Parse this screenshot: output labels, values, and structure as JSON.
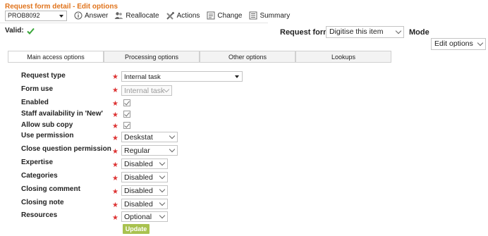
{
  "header": {
    "title": "Request form detail - Edit options",
    "record_id": "PROB8092",
    "actions": [
      {
        "label": "Answer",
        "icon": "info-icon"
      },
      {
        "label": "Reallocate",
        "icon": "users-icon"
      },
      {
        "label": "Actions",
        "icon": "tools-icon"
      },
      {
        "label": "Change",
        "icon": "edit-icon"
      },
      {
        "label": "Summary",
        "icon": "list-icon"
      }
    ],
    "valid_label": "Valid:",
    "request_form_label": "Request form",
    "request_form_value": "Digitise this item",
    "mode_label": "Mode",
    "mode_value": "Edit options"
  },
  "tabs": [
    {
      "label": "Main access options",
      "active": true
    },
    {
      "label": "Processing options",
      "active": false
    },
    {
      "label": "Other options",
      "active": false
    },
    {
      "label": "Lookups",
      "active": false
    }
  ],
  "form": {
    "required_marker": "★",
    "fields": {
      "request_type": {
        "label": "Request type",
        "value": "Internal task"
      },
      "form_use": {
        "label": "Form use",
        "value": "Internal task"
      },
      "enabled": {
        "label": "Enabled",
        "checked": true
      },
      "staff_availability": {
        "label": "Staff availability in 'New'",
        "checked": true
      },
      "allow_sub_copy": {
        "label": "Allow sub copy",
        "checked": true
      },
      "use_permission": {
        "label": "Use permission",
        "value": "Deskstat"
      },
      "close_question_permission": {
        "label": "Close question permission",
        "value": "Regular"
      },
      "expertise": {
        "label": "Expertise",
        "value": "Disabled"
      },
      "categories": {
        "label": "Categories",
        "value": "Disabled"
      },
      "closing_comment": {
        "label": "Closing comment",
        "value": "Disabled"
      },
      "closing_note": {
        "label": "Closing note",
        "value": "Disabled"
      },
      "resources": {
        "label": "Resources",
        "value": "Optional"
      }
    },
    "update_label": "Update"
  },
  "colors": {
    "title": "#e0731b",
    "required": "#dd3333",
    "valid_check": "#3aa63a",
    "update_button": "#a9c24f"
  }
}
